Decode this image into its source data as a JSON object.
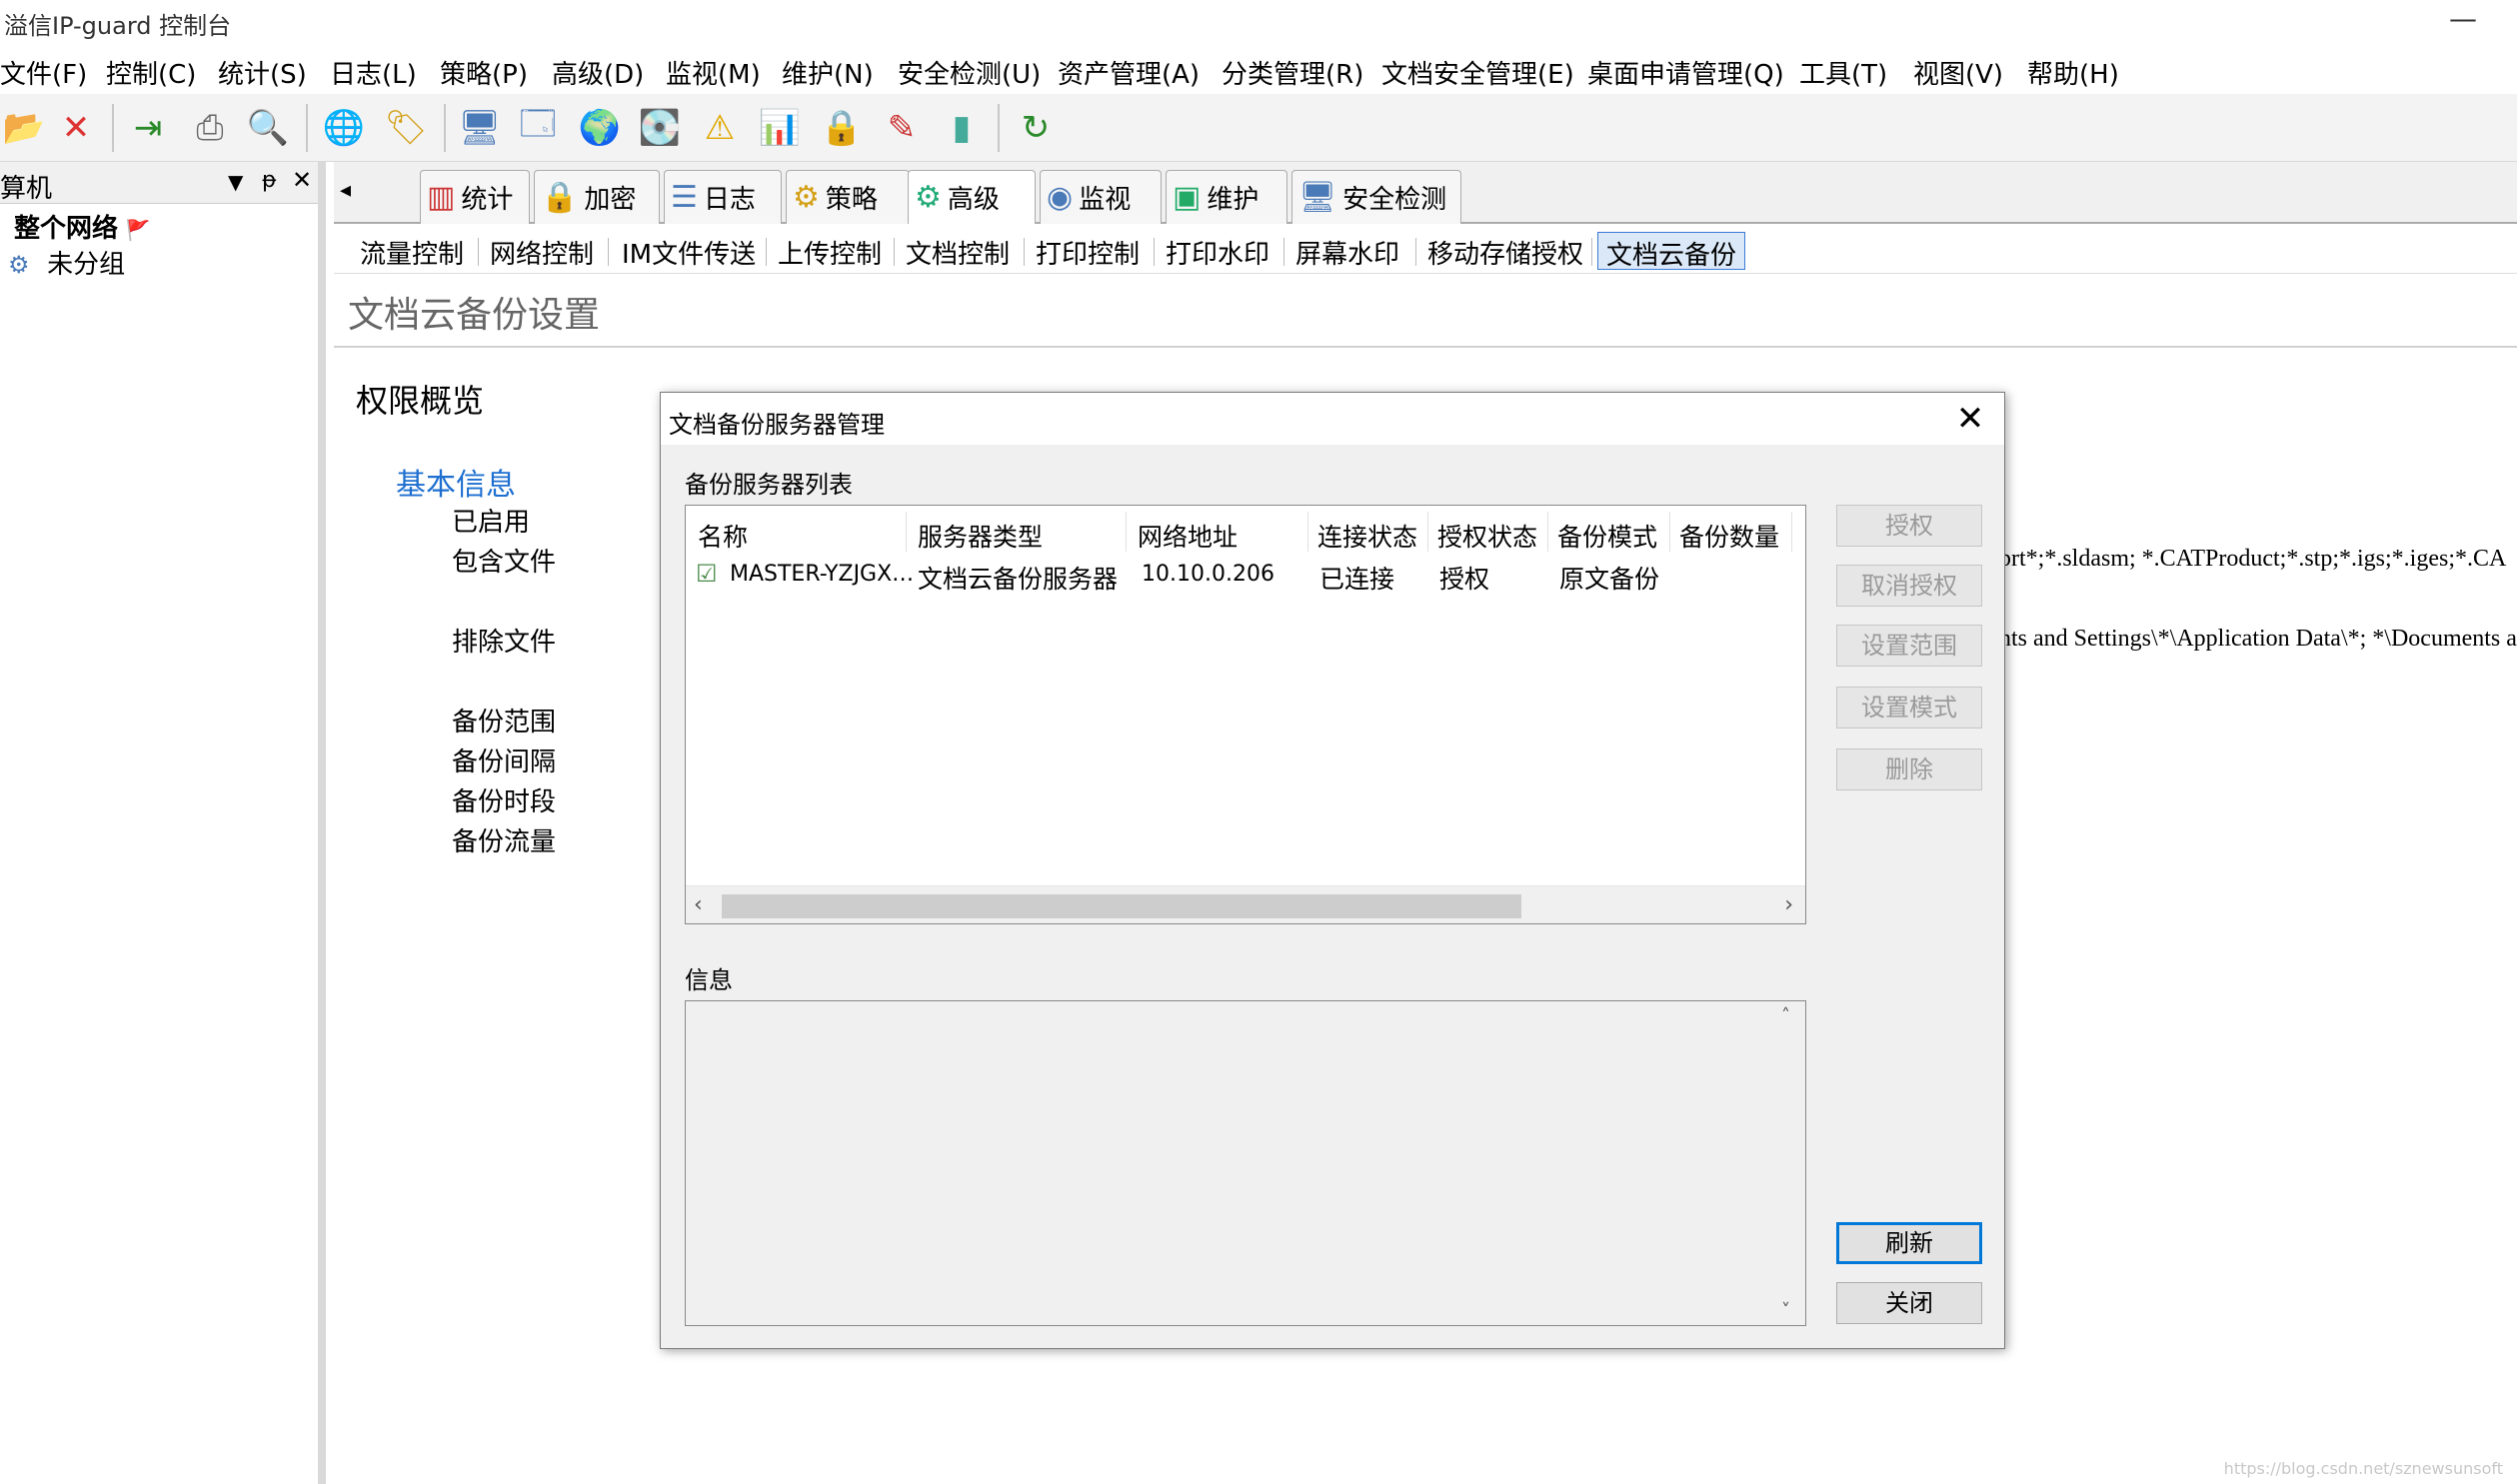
{
  "window": {
    "title": "溢信IP-guard 控制台",
    "minimize": "—"
  },
  "menu": [
    "文件(F)",
    "控制(C)",
    "统计(S)",
    "日志(L)",
    "策略(P)",
    "高级(D)",
    "监视(M)",
    "维护(N)",
    "安全检测(U)",
    "资产管理(A)",
    "分类管理(R)",
    "文档安全管理(E)",
    "桌面申请管理(Q)",
    "工具(T)",
    "视图(V)",
    "帮助(H)"
  ],
  "left_panel": {
    "title": "算机",
    "controls": {
      "dropdown": "▼",
      "pin": "ᵽ",
      "close": "✕"
    },
    "tree": [
      {
        "label": "整个网络",
        "flag": "🚩"
      },
      {
        "label": "未分组"
      }
    ]
  },
  "tabs": [
    {
      "label": "统计",
      "icon": "bar-chart-icon"
    },
    {
      "label": "加密",
      "icon": "lock-icon"
    },
    {
      "label": "日志",
      "icon": "log-icon"
    },
    {
      "label": "策略",
      "icon": "policy-icon"
    },
    {
      "label": "高级",
      "icon": "advanced-icon"
    },
    {
      "label": "监视",
      "icon": "monitor-icon"
    },
    {
      "label": "维护",
      "icon": "maintenance-icon"
    },
    {
      "label": "安全检测",
      "icon": "security-check-icon"
    }
  ],
  "subtabs": [
    "流量控制",
    "网络控制",
    "IM文件传送",
    "上传控制",
    "文档控制",
    "打印控制",
    "打印水印",
    "屏幕水印",
    "移动存储授权",
    "文档云备份"
  ],
  "section_title": "文档云备份设置",
  "permission_overview": "权限概览",
  "basic_info": "基本信息",
  "fields": [
    "已启用",
    "包含文件",
    "排除文件",
    "备份范围",
    "备份间隔",
    "备份时段",
    "备份流量"
  ],
  "background_texts": {
    "include_tail": "prt*;*.sldasm; *.CATProduct;*.stp;*.igs;*.iges;*.CA",
    "exclude_tail": "nts and Settings\\*\\Application Data\\*; *\\Documents a"
  },
  "dialog": {
    "title": "文档备份服务器管理",
    "list_group": "备份服务器列表",
    "columns": [
      "名称",
      "服务器类型",
      "网络地址",
      "连接状态",
      "授权状态",
      "备份模式",
      "备份数量"
    ],
    "rows": [
      {
        "name": "MASTER-YZJGX…",
        "type": "文档云备份服务器",
        "address": "10.10.0.206",
        "conn": "已连接",
        "auth": "授权",
        "mode": "原文备份",
        "count": ""
      }
    ],
    "info_group": "信息",
    "buttons": {
      "authorize": "授权",
      "revoke": "取消授权",
      "set_range": "设置范围",
      "set_mode": "设置模式",
      "delete": "删除",
      "refresh": "刷新",
      "close": "关闭"
    }
  },
  "watermark": "https://blog.csdn.net/sznewsunsoft"
}
